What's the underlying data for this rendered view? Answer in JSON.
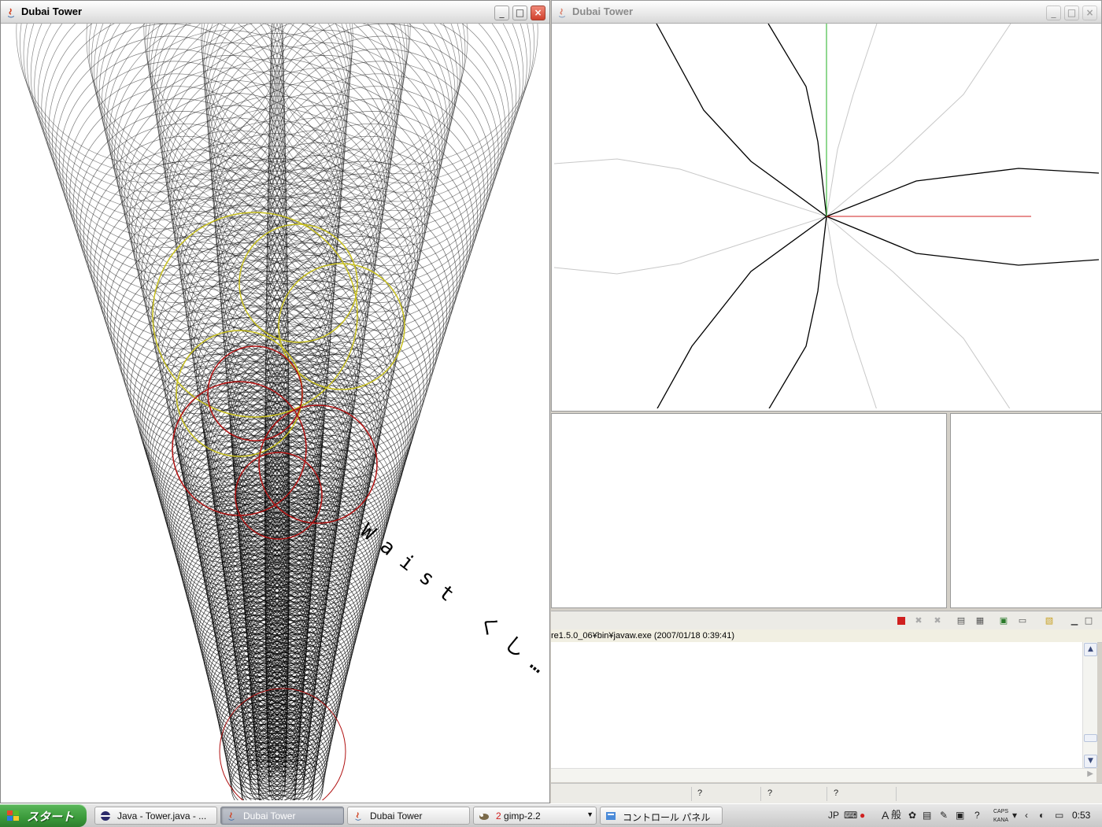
{
  "left_window": {
    "title": "Dubai Tower",
    "minimize": "_",
    "maximize": "□",
    "close": "×",
    "annotation": "Waist くし…"
  },
  "right_window": {
    "title": "Dubai Tower",
    "minimize": "_",
    "maximize": "□",
    "close": "×"
  },
  "console": {
    "header": "re1.5.0_06¥bin¥javaw.exe (2007/01/18 0:39:41)"
  },
  "statusbar": {
    "cells": [
      "?",
      "?",
      "?"
    ]
  },
  "taskbar": {
    "start_label": "スタート",
    "tasks": [
      {
        "label": "Java - Tower.java - ...",
        "icon": "eclipse-icon"
      },
      {
        "label": "Dubai Tower",
        "icon": "java-icon",
        "active": true
      },
      {
        "label": "Dubai Tower",
        "icon": "java-icon"
      },
      {
        "label_num": "2",
        "label": "gimp-2.2",
        "icon": "gimp-icon"
      },
      {
        "label": "コントロール パネル",
        "icon": "control-panel-icon"
      }
    ],
    "tray": {
      "lang": "JP",
      "ime_mode": "A",
      "ime_kanji": "般",
      "caps": "CAPS",
      "kana": "KANA",
      "help": "?",
      "clock": "0:53"
    }
  },
  "colors": {
    "axis_x": "#d02020",
    "axis_y": "#20b020",
    "yellow_rings": "#c8c020",
    "red_rings": "#b01010"
  }
}
